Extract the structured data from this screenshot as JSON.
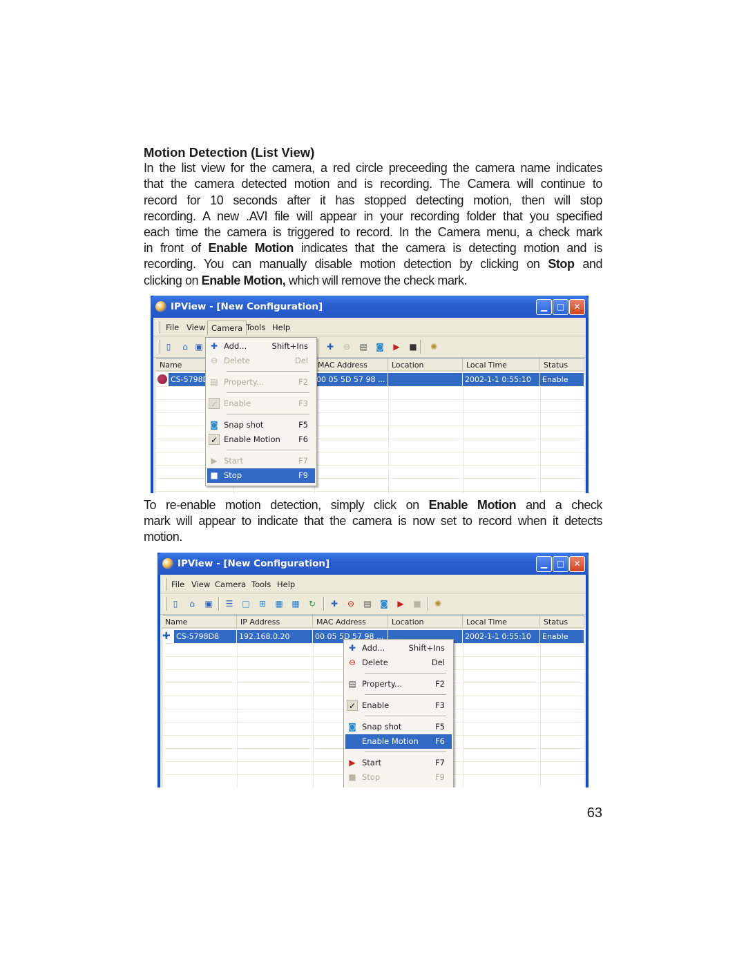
{
  "document": {
    "heading": "Motion Detection (List View)",
    "paragraph1": [
      [
        {
          "t": "In the list view for the camera, a red circle preceeding  the camera name indicates"
        }
      ],
      [
        {
          "t": "that the camera detected motion and is recording.  The Camera will continue to"
        }
      ],
      [
        {
          "t": "record for 10 seconds after it has stopped detecting motion, then will stop"
        }
      ],
      [
        {
          "t": "recording.  A new .AVI file will appear in your recording folder that you specified"
        }
      ],
      [
        {
          "t": "each time the camera is triggered to record.  In the Camera menu, a check mark"
        }
      ],
      [
        {
          "t": "in front of "
        },
        {
          "t": "Enable Motion",
          "b": true
        },
        {
          "t": " indicates that the camera is detecting motion and is"
        }
      ],
      [
        {
          "t": "recording.  You can manually disable motion detection by clicking on "
        },
        {
          "t": "Stop",
          "b": true
        },
        {
          "t": " and"
        }
      ],
      [
        {
          "t": "clicking on "
        },
        {
          "t": "Enable Motion,",
          "b": true
        },
        {
          "t": " which will remove the check mark."
        }
      ]
    ],
    "paragraph2": [
      [
        {
          "t": "To re-enable motion detection, simply click on "
        },
        {
          "t": "Enable Motion",
          "b": true
        },
        {
          "t": " and a check"
        }
      ],
      [
        {
          "t": "mark will appear to indicate that the camera is now set to record when it detects"
        }
      ],
      [
        {
          "t": "motion."
        }
      ]
    ],
    "page_number": "63"
  },
  "windows": [
    {
      "title": "IPView - [New Configuration]",
      "menu": [
        "File",
        "View",
        "Camera",
        "Tools",
        "Help"
      ],
      "active_menu": "Camera",
      "toolbar_icons": [
        "new-icon",
        "open-icon",
        "save-icon",
        "add-camera-icon",
        "delete-camera-icon",
        "property-icon",
        "snapshot-icon",
        "start-icon",
        "stop-icon",
        "settings-icon"
      ],
      "columns": [
        "Name",
        "",
        "MAC Address",
        "Location",
        "Local Time",
        "Status"
      ],
      "row": {
        "icon": "red-circle-recording-icon",
        "name": "CS-5798D8",
        "ip": "",
        "mac": "00 05 5D 57 98 ...",
        "location": "",
        "time": "2002-1-1  0:55:10",
        "status": "Enable"
      },
      "context_menu": [
        {
          "label": "Add...",
          "shortcut": "Shift+Ins",
          "icon": "add-camera-icon"
        },
        {
          "label": "Delete",
          "shortcut": "Del",
          "icon": "delete-camera-icon",
          "disabled": true
        },
        {
          "separator": true
        },
        {
          "label": "Property...",
          "shortcut": "F2",
          "icon": "property-icon",
          "disabled": true
        },
        {
          "separator": true
        },
        {
          "label": "Enable",
          "shortcut": "F3",
          "icon": "check-icon",
          "checked": true,
          "disabled": true
        },
        {
          "separator": true
        },
        {
          "label": "Snap shot",
          "shortcut": "F5",
          "icon": "snapshot-icon"
        },
        {
          "label": "Enable Motion",
          "shortcut": "F6",
          "icon": "check-icon",
          "checked": true
        },
        {
          "separator": true
        },
        {
          "label": "Start",
          "shortcut": "F7",
          "icon": "start-icon",
          "disabled": true
        },
        {
          "label": "Stop",
          "shortcut": "F9",
          "icon": "stop-icon",
          "highlighted": true
        }
      ]
    },
    {
      "title": "IPView - [New Configuration]",
      "menu": [
        "File",
        "View",
        "Camera",
        "Tools",
        "Help"
      ],
      "active_menu": "",
      "toolbar_icons": [
        "new-icon",
        "open-icon",
        "save-icon",
        "list-view-icon",
        "single-view-icon",
        "quad-view-icon",
        "nine-view-icon",
        "sixteen-view-icon",
        "refresh-icon",
        "add-camera-icon",
        "delete-camera-icon",
        "property-icon",
        "snapshot-icon",
        "start-icon",
        "stop-icon",
        "settings-icon"
      ],
      "columns": [
        "Name",
        "IP Address",
        "MAC Address",
        "Location",
        "Local Time",
        "Status"
      ],
      "row": {
        "icon": "camera-icon",
        "name": "CS-5798D8",
        "ip": "192.168.0.20",
        "mac": "00 05 5D 57 98 ...",
        "location": "",
        "time": "2002-1-1  0:55:10",
        "status": "Enable"
      },
      "context_menu": [
        {
          "label": "Add...",
          "shortcut": "Shift+Ins",
          "icon": "add-camera-icon"
        },
        {
          "label": "Delete",
          "shortcut": "Del",
          "icon": "delete-camera-icon"
        },
        {
          "separator": true
        },
        {
          "label": "Property...",
          "shortcut": "F2",
          "icon": "property-icon"
        },
        {
          "separator": true
        },
        {
          "label": "Enable",
          "shortcut": "F3",
          "icon": "check-icon",
          "checked": true
        },
        {
          "separator": true
        },
        {
          "label": "Snap shot",
          "shortcut": "F5",
          "icon": "snapshot-icon"
        },
        {
          "label": "Enable Motion",
          "shortcut": "F6",
          "icon": "none",
          "highlighted": true
        },
        {
          "separator": true
        },
        {
          "label": "Start",
          "shortcut": "F7",
          "icon": "start-icon"
        },
        {
          "label": "Stop",
          "shortcut": "F9",
          "icon": "stop-icon",
          "disabled": true
        }
      ]
    }
  ],
  "colors": {
    "selection": "#316ac5",
    "titlebar": "#2456c6",
    "menu_bg": "#ece9d8",
    "recording_dot": "#8b1a3a"
  }
}
